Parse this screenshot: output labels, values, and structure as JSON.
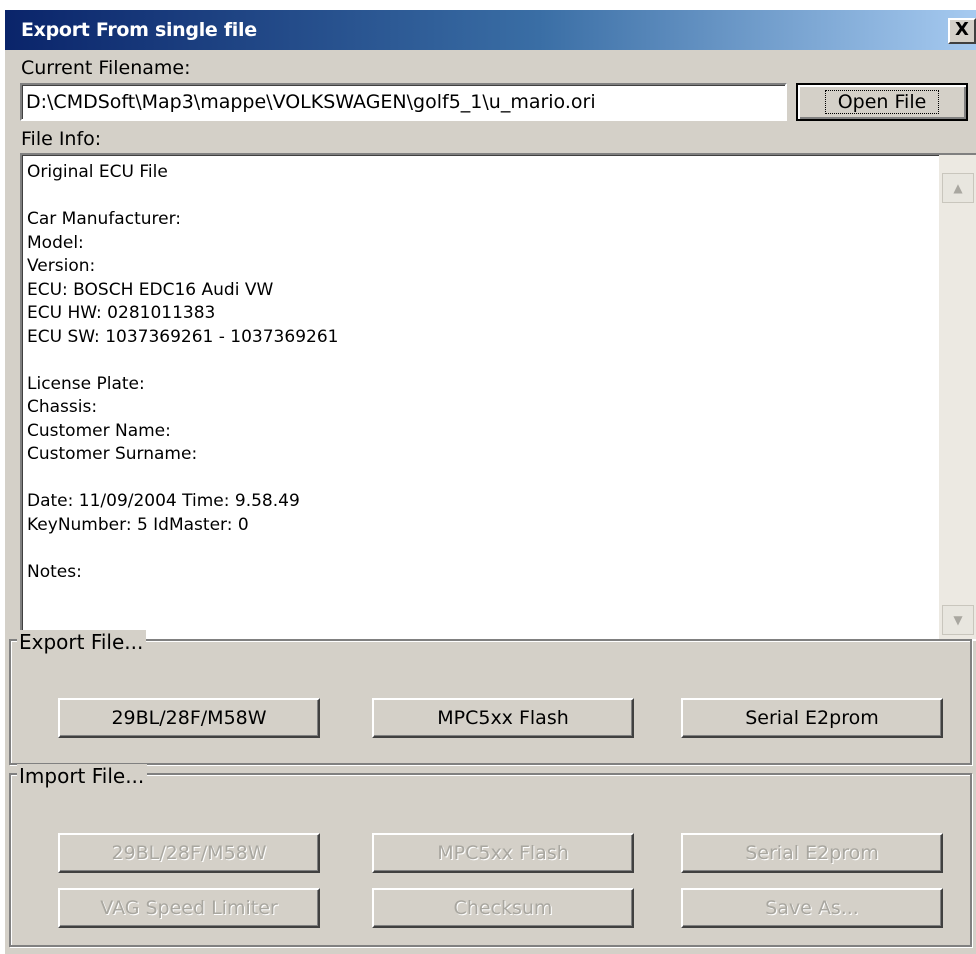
{
  "window": {
    "title": "Export From single file",
    "close_glyph": "X"
  },
  "current_filename": {
    "label": "Current Filename:",
    "value": "D:\\CMDSoft\\Map3\\mappe\\VOLKSWAGEN\\golf5_1\\u_mario.ori",
    "open_button": "Open File"
  },
  "file_info": {
    "label": "File Info:",
    "lines": [
      "Original ECU File",
      "",
      "Car Manufacturer:",
      "Model:",
      "Version:",
      "ECU:   BOSCH EDC16 Audi VW",
      "ECU HW:   0281011383",
      "ECU SW:   1037369261 - 1037369261",
      "",
      "License Plate:",
      "Chassis:",
      "Customer Name:",
      "Customer Surname:",
      "",
      "Date:   11/09/2004    Time:   9.58.49",
      "KeyNumber:   5     IdMaster:   0",
      "",
      "Notes:"
    ],
    "scroll_up_icon": "scroll-up-arrow",
    "scroll_down_icon": "scroll-down-arrow"
  },
  "export": {
    "label": "Export File...",
    "buttons": [
      "29BL/28F/M58W",
      "MPC5xx Flash",
      "Serial E2prom"
    ]
  },
  "import": {
    "label": "Import File...",
    "buttons_row1": [
      "29BL/28F/M58W",
      "MPC5xx Flash",
      "Serial E2prom"
    ],
    "buttons_row2": [
      "VAG Speed Limiter",
      "Checksum",
      "Save As..."
    ],
    "disabled": true
  },
  "colors": {
    "titlebar_start": "#0a246a",
    "titlebar_end": "#a6caf0",
    "face": "#d4d0c8",
    "disabled_text": "#a9a7a0"
  }
}
